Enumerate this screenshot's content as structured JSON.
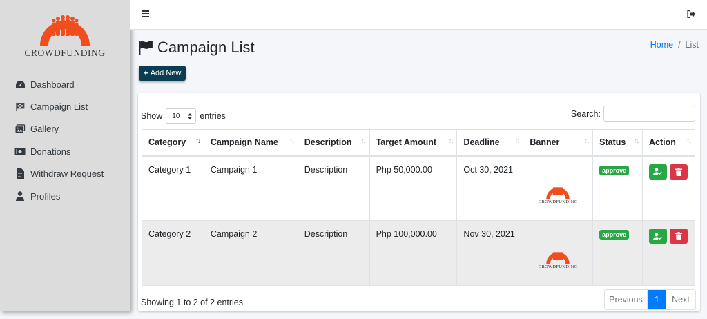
{
  "brand": {
    "name": "CROWDFUNDING",
    "accent": "#f04e1f"
  },
  "sidebar": {
    "items": [
      {
        "label": "Dashboard",
        "icon": "tachometer-icon"
      },
      {
        "label": "Campaign List",
        "icon": "flag-checkered-icon"
      },
      {
        "label": "Gallery",
        "icon": "images-icon"
      },
      {
        "label": "Donations",
        "icon": "money-bill-icon"
      },
      {
        "label": "Withdraw Request",
        "icon": "file-invoice-icon"
      },
      {
        "label": "Profiles",
        "icon": "user-icon"
      }
    ]
  },
  "header": {
    "title": "Campaign List",
    "breadcrumb": {
      "home": "Home",
      "separator": "/",
      "current": "List"
    },
    "add_label": "Add New"
  },
  "table_controls": {
    "show_label": "Show",
    "page_size": "10",
    "entries_label": "entries",
    "search_label": "Search:",
    "search_value": ""
  },
  "table": {
    "columns": [
      "Category",
      "Campaign Name",
      "Description",
      "Target Amount",
      "Deadline",
      "Banner",
      "Status",
      "Action"
    ],
    "rows": [
      {
        "category": "Category 1",
        "name": "Campaign 1",
        "description": "Description",
        "target": "Php 50,000.00",
        "deadline": "Oct 30, 2021",
        "banner_text": "CROWDFUNDING",
        "status": "approve"
      },
      {
        "category": "Category 2",
        "name": "Campaign 2",
        "description": "Description",
        "target": "Php 100,000.00",
        "deadline": "Nov 30, 2021",
        "banner_text": "CROWDFUNDING",
        "status": "approve"
      }
    ]
  },
  "footer": {
    "info": "Showing 1 to 2 of 2 entries",
    "prev": "Previous",
    "page": "1",
    "next": "Next"
  },
  "colors": {
    "primary": "#007bff",
    "success": "#28a745",
    "danger": "#dc3545",
    "add_button": "#0b3d52"
  }
}
